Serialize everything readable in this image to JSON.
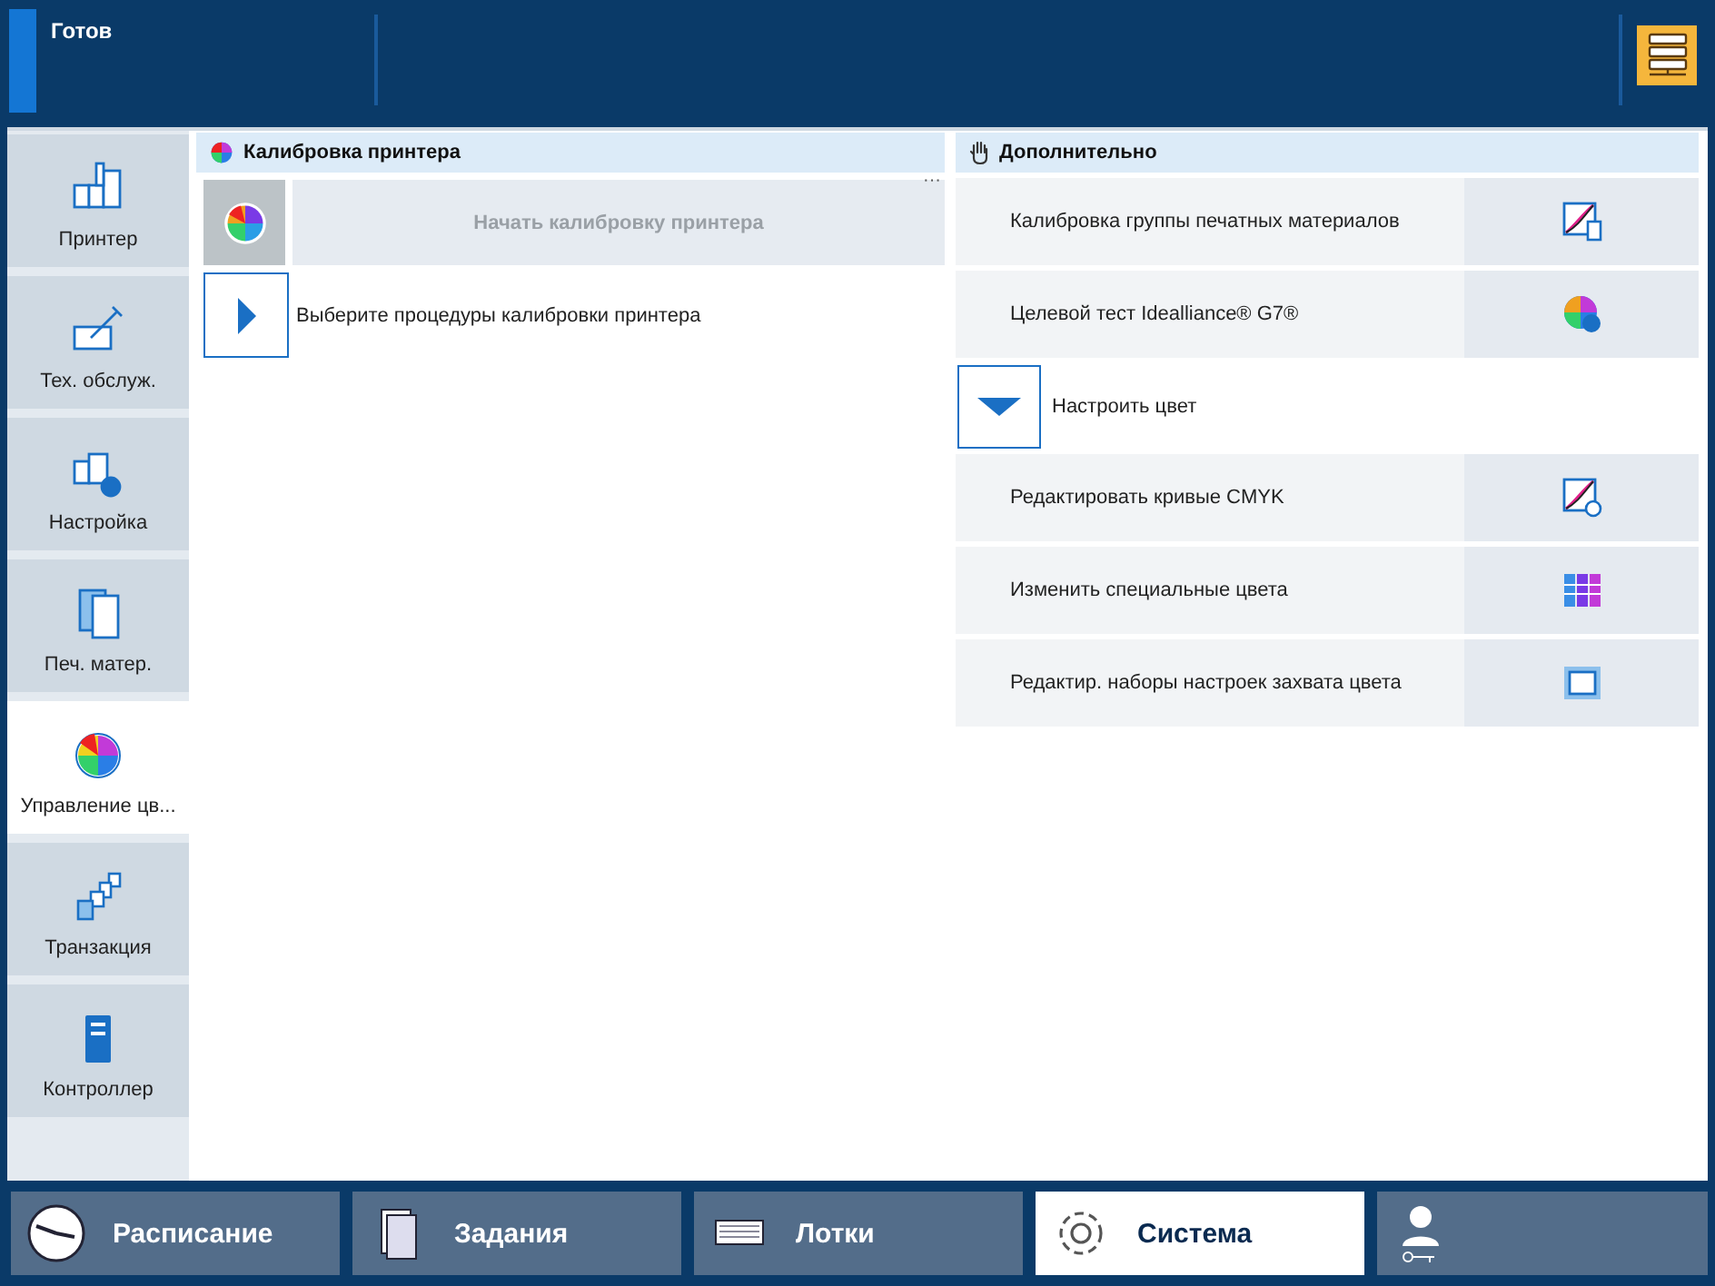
{
  "status_bar": {
    "state": "Готов"
  },
  "sidebar": {
    "items": [
      {
        "label": "Принтер",
        "selected": false
      },
      {
        "label": "Тех. обслуж.",
        "selected": false
      },
      {
        "label": "Настройка",
        "selected": false
      },
      {
        "label": "Печ. матер.",
        "selected": false
      },
      {
        "label": "Управление цв...",
        "selected": true
      },
      {
        "label": "Транзакция",
        "selected": false
      },
      {
        "label": "Контроллер",
        "selected": false
      }
    ]
  },
  "calibration_panel": {
    "title": "Калибровка принтера",
    "more": "···",
    "start_button": {
      "label": "Начать калибровку принтера",
      "disabled": true
    },
    "procedures": {
      "label": "Выберите процедуры калибровки принтера",
      "expanded": false
    }
  },
  "advanced_panel": {
    "title": "Дополнительно",
    "rows": [
      {
        "kind": "action",
        "label": "Калибровка группы печатных материалов"
      },
      {
        "kind": "action",
        "label": "Целевой тест Idealliance® G7®"
      },
      {
        "kind": "group",
        "label": "Настроить цвет",
        "expanded": true
      },
      {
        "kind": "action",
        "label": "Редактировать кривые CMYK"
      },
      {
        "kind": "action",
        "label": "Изменить специальные цвета"
      },
      {
        "kind": "action",
        "label": "Редактир. наборы настроек захвата цвета"
      }
    ]
  },
  "bottom_tabs": [
    {
      "label": "Расписание",
      "selected": false
    },
    {
      "label": "Задания",
      "selected": false
    },
    {
      "label": "Лотки",
      "selected": false
    },
    {
      "label": "Система",
      "selected": true
    }
  ]
}
